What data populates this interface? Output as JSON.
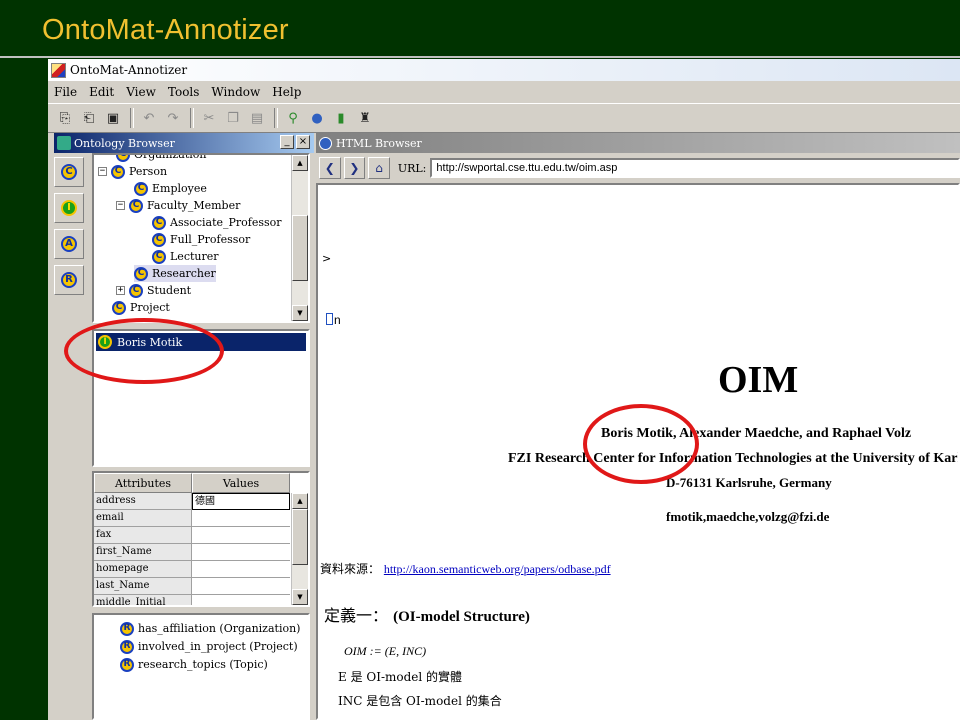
{
  "slide": {
    "title": "OntoMat-Annotizer"
  },
  "window": {
    "title": "OntoMat-Annotizer"
  },
  "menu": [
    "File",
    "Edit",
    "View",
    "Tools",
    "Window",
    "Help"
  ],
  "toolbar_icons": [
    "open-ontology-icon",
    "open-file-icon",
    "save-icon",
    "undo-icon",
    "redo-icon",
    "cut-icon",
    "copy-icon",
    "paste-icon",
    "plugin-icon",
    "globe-icon",
    "database-icon",
    "agent-icon"
  ],
  "side_buttons": [
    {
      "icon": "class-icon",
      "letter": "C"
    },
    {
      "icon": "instance-icon",
      "letter": "I"
    },
    {
      "icon": "attribute-icon",
      "letter": "A"
    },
    {
      "icon": "relation-icon",
      "letter": "R"
    }
  ],
  "ontology_browser": {
    "title": "Ontology Browser",
    "tree": [
      {
        "label": "Organization",
        "letter": "C"
      },
      {
        "label": "Person",
        "letter": "C"
      },
      {
        "label": "Employee",
        "letter": "C"
      },
      {
        "label": "Faculty_Member",
        "letter": "C"
      },
      {
        "label": "Associate_Professor",
        "letter": "C"
      },
      {
        "label": "Full_Professor",
        "letter": "C"
      },
      {
        "label": "Lecturer",
        "letter": "C"
      },
      {
        "label": "Researcher",
        "letter": "C"
      },
      {
        "label": "Student",
        "letter": "C"
      },
      {
        "label": "Project",
        "letter": "C"
      }
    ],
    "instances": [
      {
        "label": "Boris Motik",
        "letter": "I"
      }
    ],
    "attributes": {
      "headers": [
        "Attributes",
        "Values"
      ],
      "rows": [
        {
          "key": "address",
          "value": "德國"
        },
        {
          "key": "email",
          "value": ""
        },
        {
          "key": "fax",
          "value": ""
        },
        {
          "key": "first_Name",
          "value": ""
        },
        {
          "key": "homepage",
          "value": ""
        },
        {
          "key": "last_Name",
          "value": ""
        },
        {
          "key": "middle_Initial",
          "value": ""
        }
      ]
    },
    "relations": [
      {
        "label": "has_affiliation (Organization)",
        "letter": "R"
      },
      {
        "label": "involved_in_project (Project)",
        "letter": "R"
      },
      {
        "label": "research_topics (Topic)",
        "letter": "R"
      }
    ]
  },
  "html_browser": {
    "title": "HTML Browser",
    "url_label": "URL:",
    "url": "http://swportal.cse.ttu.edu.tw/oim.asp",
    "content": {
      "gt": ">",
      "broken": "n",
      "title": "OIM",
      "authors": "Boris Motik, Alexander Maedche, and Raphael Volz",
      "institution": "FZI Research Center for Information Technologies at the University of Karlsruhe",
      "address": "D-76131 Karlsruhe, Germany",
      "emails": "fmotik,maedche,volzg@fzi.de",
      "source_label": "資料來源：",
      "source_link": "http://kaon.semanticweb.org/papers/odbase.pdf",
      "definition_label": "定義一：",
      "definition_title": "(OI-model Structure)",
      "equation": "OIM := (E, INC)",
      "line_e": "E 是 OI-model 的實體",
      "line_inc": "INC 是包含 OI-model 的集合"
    }
  },
  "colors": {
    "slide_bg": "#003300",
    "slide_title": "#F0C030",
    "annotation": "#E01818",
    "selection": "#0A246A"
  }
}
